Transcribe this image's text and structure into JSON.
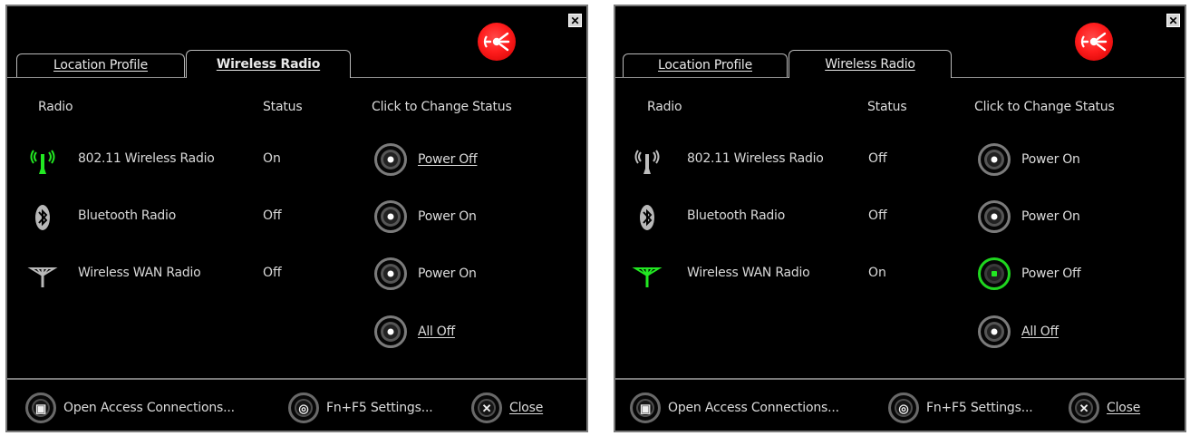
{
  "screens": [
    {
      "close_glyph": "✕",
      "tabs": [
        "Location Profile",
        "Wireless Radio"
      ],
      "headers": {
        "radio": "Radio",
        "status": "Status",
        "action": "Click to Change Status"
      },
      "radios": [
        {
          "name": "802.11 Wireless Radio",
          "status": "On",
          "action": "Power Off",
          "icon": "wifi-icon"
        },
        {
          "name": "Bluetooth Radio",
          "status": "Off",
          "action": "Power On",
          "icon": "bluetooth-icon"
        },
        {
          "name": "Wireless WAN Radio",
          "status": "Off",
          "action": "Power On",
          "icon": "antenna-icon"
        }
      ],
      "all_off": "All Off",
      "footer": {
        "open": "Open Access Connections...",
        "settings": "Fn+F5 Settings...",
        "close": "Close"
      },
      "colors": {
        "accent_green": "#22e822",
        "logo_red": "#ff1d1d"
      }
    },
    {
      "close_glyph": "✕",
      "tabs": [
        "Location Profile",
        "Wireless Radio"
      ],
      "headers": {
        "radio": "Radio",
        "status": "Status",
        "action": "Click to Change Status"
      },
      "radios": [
        {
          "name": "802.11 Wireless Radio",
          "status": "Off",
          "action": "Power On",
          "icon": "wifi-icon"
        },
        {
          "name": "Bluetooth Radio",
          "status": "Off",
          "action": "Power On",
          "icon": "bluetooth-icon"
        },
        {
          "name": "Wireless WAN Radio",
          "status": "On",
          "action": "Power Off",
          "icon": "antenna-icon"
        }
      ],
      "all_off": "All Off",
      "footer": {
        "open": "Open Access Connections...",
        "settings": "Fn+F5 Settings...",
        "close": "Close"
      },
      "colors": {
        "accent_green": "#22e822",
        "logo_red": "#ff1d1d"
      }
    }
  ]
}
